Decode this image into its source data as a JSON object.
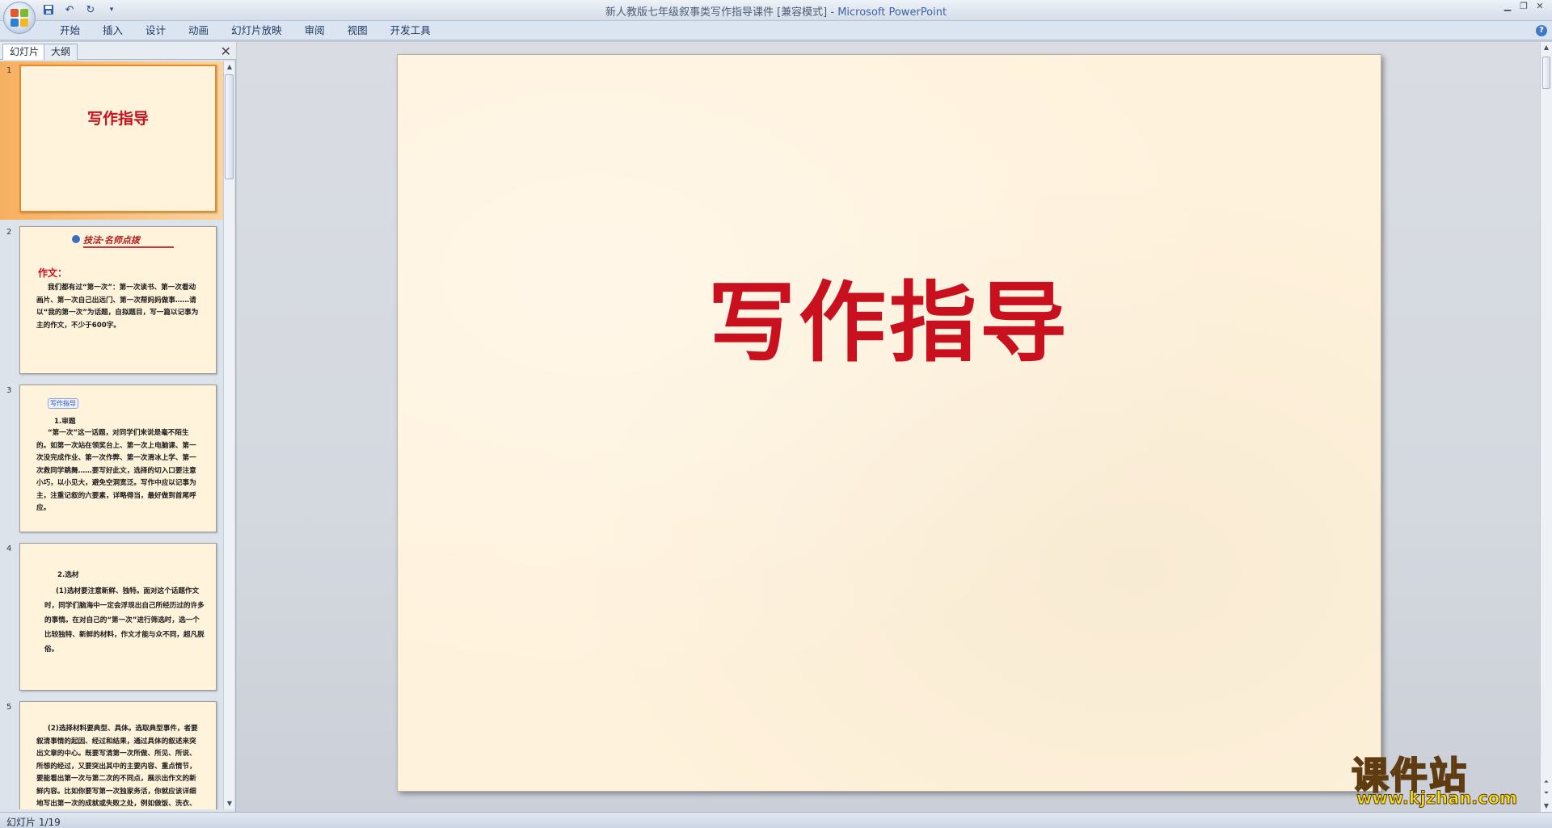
{
  "window": {
    "title": "新人教版七年级叙事类写作指导课件 [兼容模式]",
    "app_name": "Microsoft PowerPoint",
    "title_separator": " - "
  },
  "ribbon": {
    "tabs": [
      "开始",
      "插入",
      "设计",
      "动画",
      "幻灯片放映",
      "审阅",
      "视图",
      "开发工具"
    ]
  },
  "left_pane": {
    "tabs": [
      "幻灯片",
      "大纲"
    ]
  },
  "thumbnails": [
    {
      "num": "1",
      "title": "写作指导"
    },
    {
      "num": "2",
      "banner": "技法·名师点拨",
      "heading": "作文：",
      "body": "我们都有过“第一次”：第一次读书、第一次看动画片、第一次自己出远门、第一次帮妈妈做事……请以“我的第一次”为话题，自拟题目，写一篇以记事为主的作文，不少于600字。"
    },
    {
      "num": "3",
      "tag": "写作指导",
      "sub": "1.审题",
      "body": "“第一次”这一话题，对同学们来说是毫不陌生的。如第一次站在领奖台上、第一次上电脑课、第一次没完成作业、第一次作弊、第一次滑冰上学、第一次救同学跳舞……要写好此文，选择的切入口要注意小巧，以小见大，避免空洞宽泛。写作中应以记事为主，注重记叙的六要素，详略得当，最好做到首尾呼应。"
    },
    {
      "num": "4",
      "sub": "2.选材",
      "body": "(1)选材要注意新鲜、独特。面对这个话题作文时，同学们脑海中一定会浮现出自己所经历过的许多的事情。在对自己的“第一次”进行筛选时，选一个比较独特、新鲜的材料，作文才能与众不同，超凡脱俗。"
    },
    {
      "num": "5",
      "body": "(2)选择材料要典型、具体。选取典型事件，者要叙清事情的起因、经过和结果，通过具体的叙述来突出文章的中心。既要写清第一次所做、所见、所说、所想的经过，又要突出其中的主要内容、重点情节，要能看出第一次与第二次的不同点，展示出作文的新鲜内容。比如你要写第一次独家务活，你就应该详细地写出第一次的成就或失败之处，例如做饭、洗衣、拖地……"
    }
  ],
  "slide": {
    "title": "写作指导"
  },
  "status_bar": {
    "slide_info": "幻灯片 1/19"
  },
  "watermark": {
    "brand": "课件站",
    "url": "www.kjzhan.com"
  },
  "colors": {
    "slide_title": "#c8101e",
    "selected_thumb": "#f7b061",
    "slide_bg": "#fff2dc"
  },
  "icons": {
    "office_button": "office-logo",
    "save": "save-icon",
    "undo": "undo-icon",
    "redo": "redo-icon",
    "qat_menu": "chevron-down-icon",
    "help": "help-icon",
    "close_pane": "close-icon"
  }
}
